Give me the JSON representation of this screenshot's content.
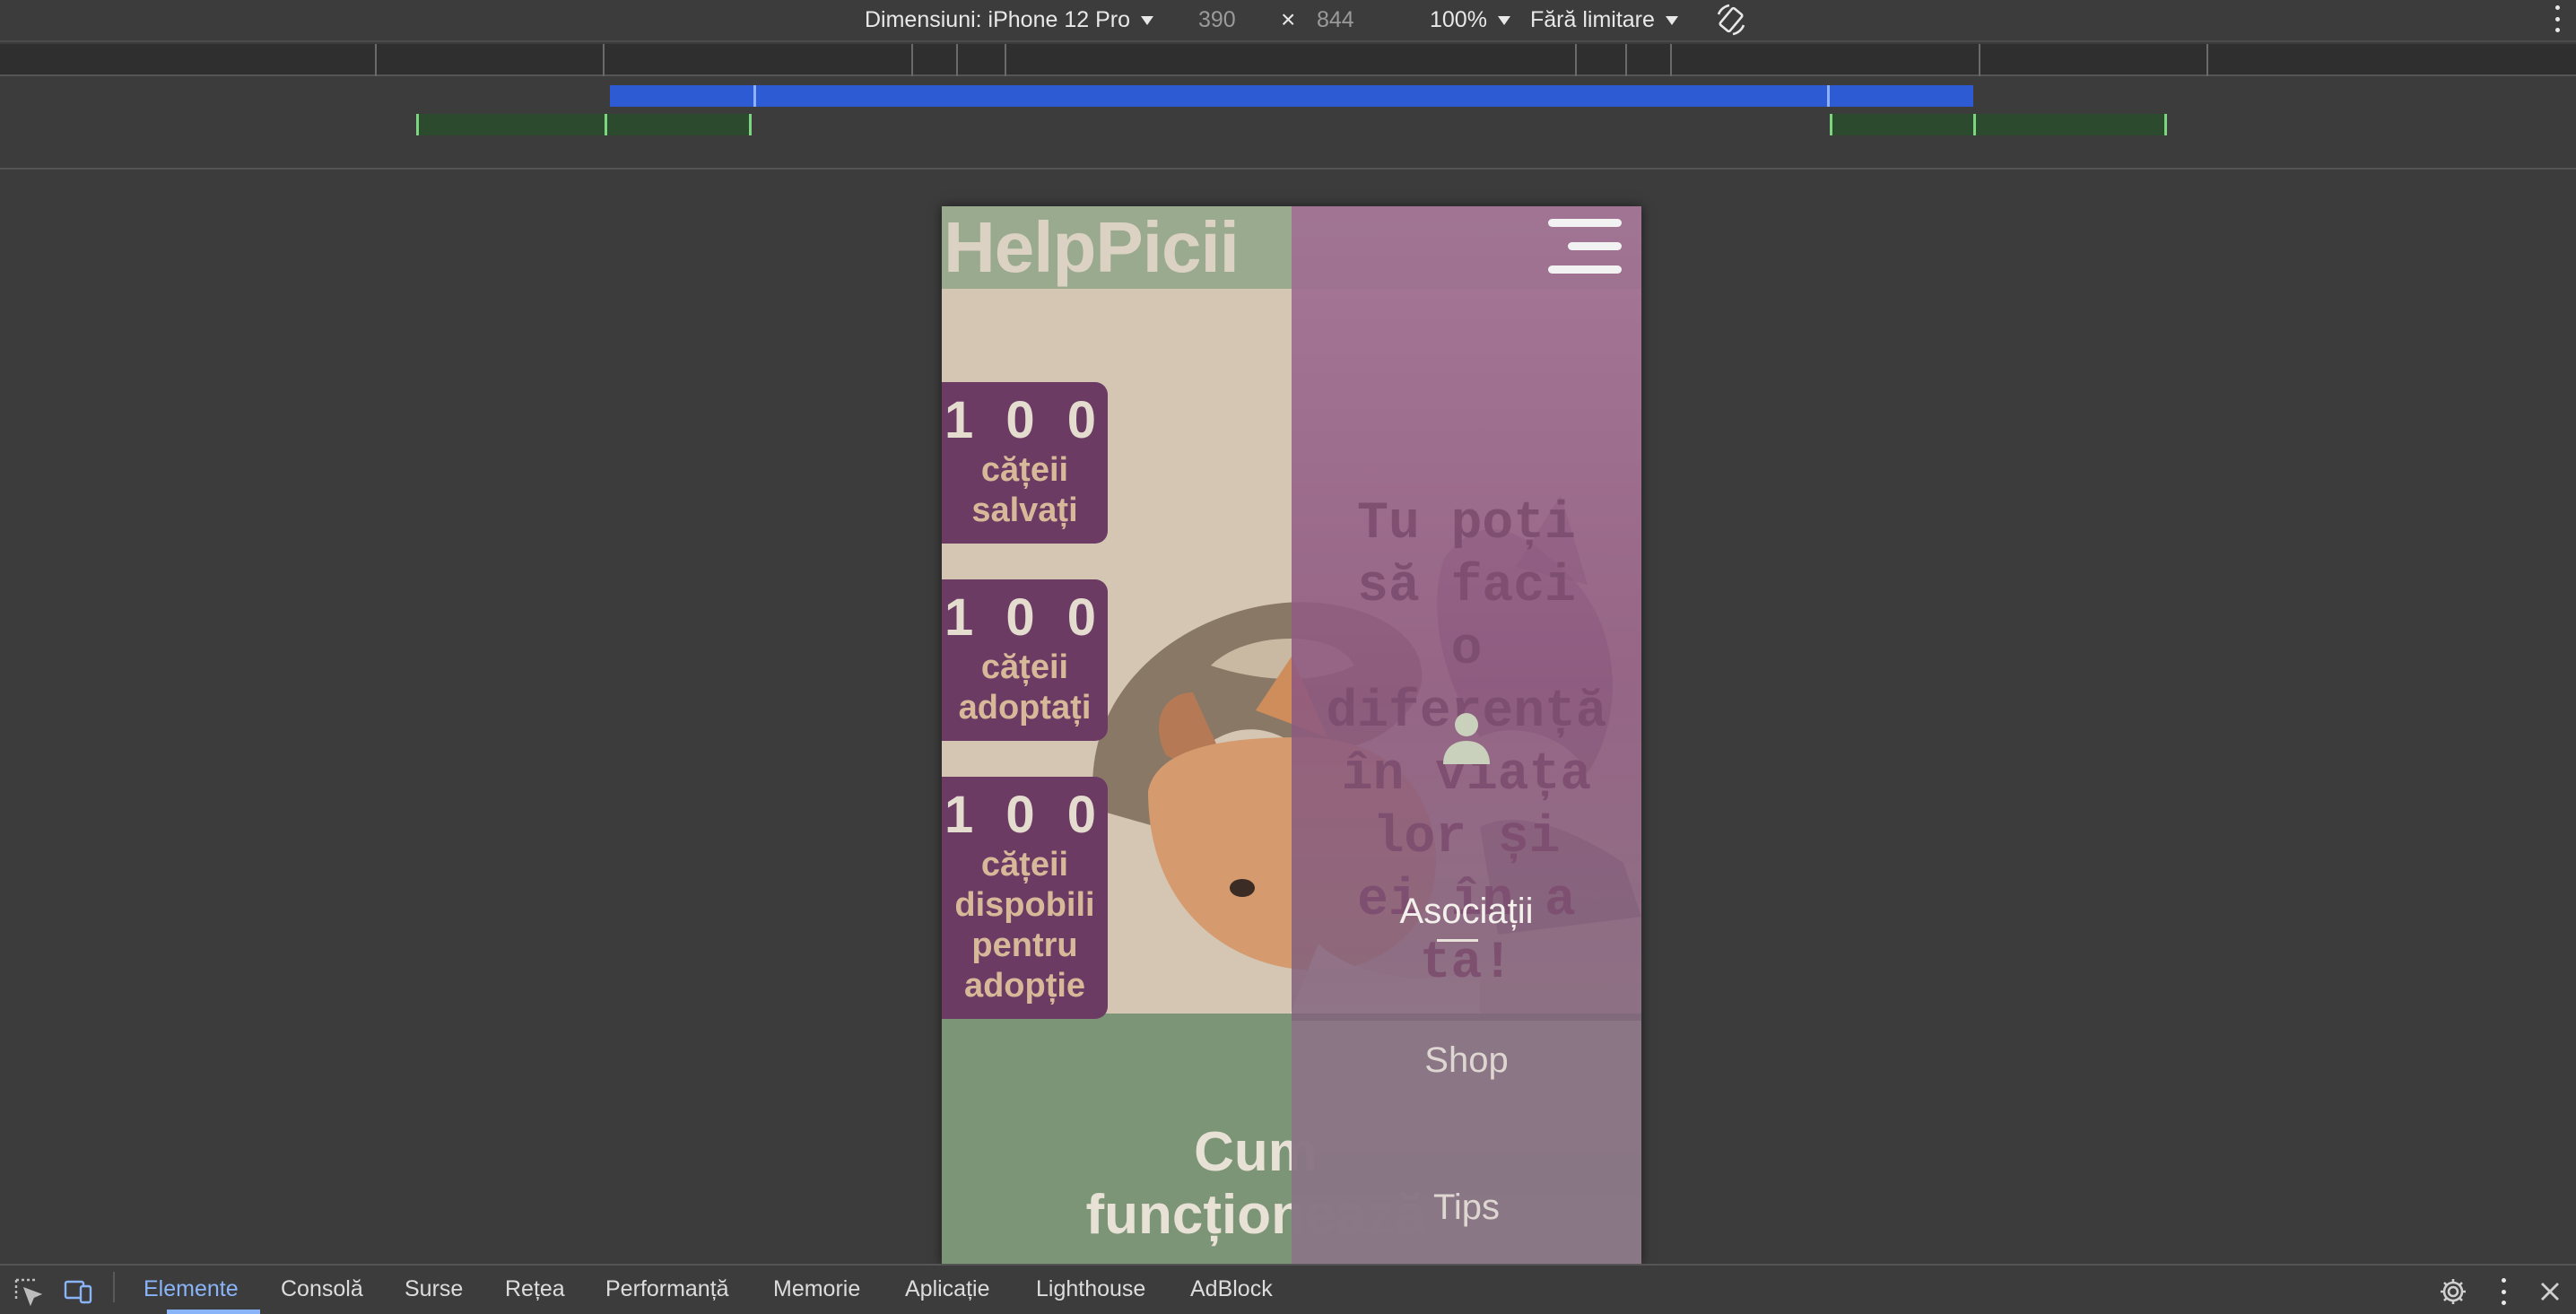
{
  "device_toolbar": {
    "dimensions_label": "Dimensiuni: iPhone 12 Pro",
    "width_value": "390",
    "times_symbol": "×",
    "height_value": "844",
    "zoom": "100%",
    "throttling": "Fără limitare"
  },
  "page": {
    "brand": "HelpPicii",
    "stats": [
      {
        "number": "1 0 0",
        "label_line1": "cățeii",
        "label_line2": "salvați"
      },
      {
        "number": "1 0 0",
        "label_line1": "cățeii",
        "label_line2": "adoptați"
      },
      {
        "number": "1 0 0",
        "label_line1": "cățeii",
        "label_line2": "dispobili",
        "label_line3": "pentru",
        "label_line4": "adopție"
      }
    ],
    "tagline_lines": [
      "Tu poți",
      "să faci",
      "o",
      "diferență",
      "în viața",
      "lor și",
      "ei în a",
      "ta!"
    ],
    "how_title_lines": [
      "Cum",
      "funcționează",
      "..."
    ],
    "menu": {
      "items": [
        "Asociații",
        "Shop",
        "Tips"
      ],
      "active": "Asociații"
    }
  },
  "devtools_tabs": [
    "Elemente",
    "Consolă",
    "Surse",
    "Rețea",
    "Performanță",
    "Memorie",
    "Aplicație",
    "Lighthouse",
    "AdBlock"
  ],
  "active_tab": "Elemente",
  "colors": {
    "devtools_bg": "#3c3c3c",
    "tab_active": "#8ab4f8",
    "card_purple": "#6b3b63",
    "header_green": "#9aaa8f",
    "menu_overlay": "#9a6a8c"
  }
}
